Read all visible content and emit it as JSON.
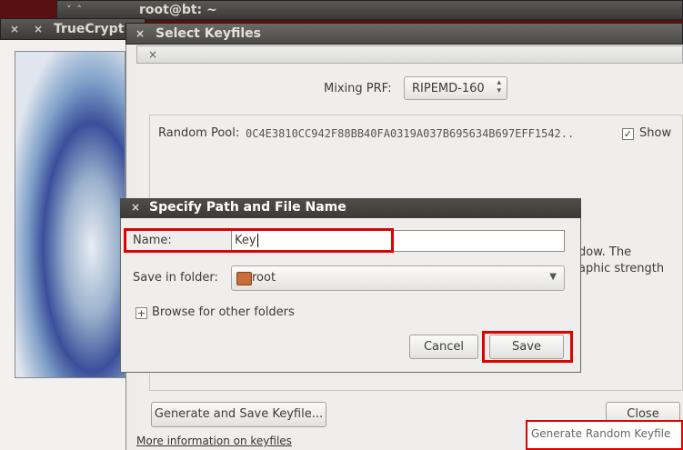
{
  "terminal": {
    "title": "root@bt: ~"
  },
  "truecrypt": {
    "title": "TrueCrypt"
  },
  "select_keyfiles": {
    "title": "Select Keyfiles",
    "mixing_prf_label": "Mixing PRF:",
    "mixing_prf_value": "RIPEMD-160",
    "random_pool_label": "Random Pool:",
    "random_pool_value": "0C4E3810CC942F88BB40FA0319A037B695634B697EFF1542..",
    "show_label": "Show",
    "show_checked": "✓",
    "partial_text_1": "dow. The",
    "partial_text_2": "aphic strength",
    "generate_button": "Generate and Save Keyfile...",
    "close_button": "Close",
    "bottom_link": "More information on keyfiles",
    "bottom_right_button": "Generate Random Keyfile"
  },
  "save_dialog": {
    "title": "Specify Path and File Name",
    "name_label": "Name:",
    "name_value": "Key",
    "folder_label": "Save in folder:",
    "folder_value": "root",
    "browse_label": "Browse for other folders",
    "cancel_button": "Cancel",
    "save_button": "Save"
  },
  "icons": {
    "close": "×",
    "expander": "+",
    "dropdown": "▼"
  },
  "colors": {
    "highlight": "#e00000",
    "title_bar": "#3c3b37"
  }
}
